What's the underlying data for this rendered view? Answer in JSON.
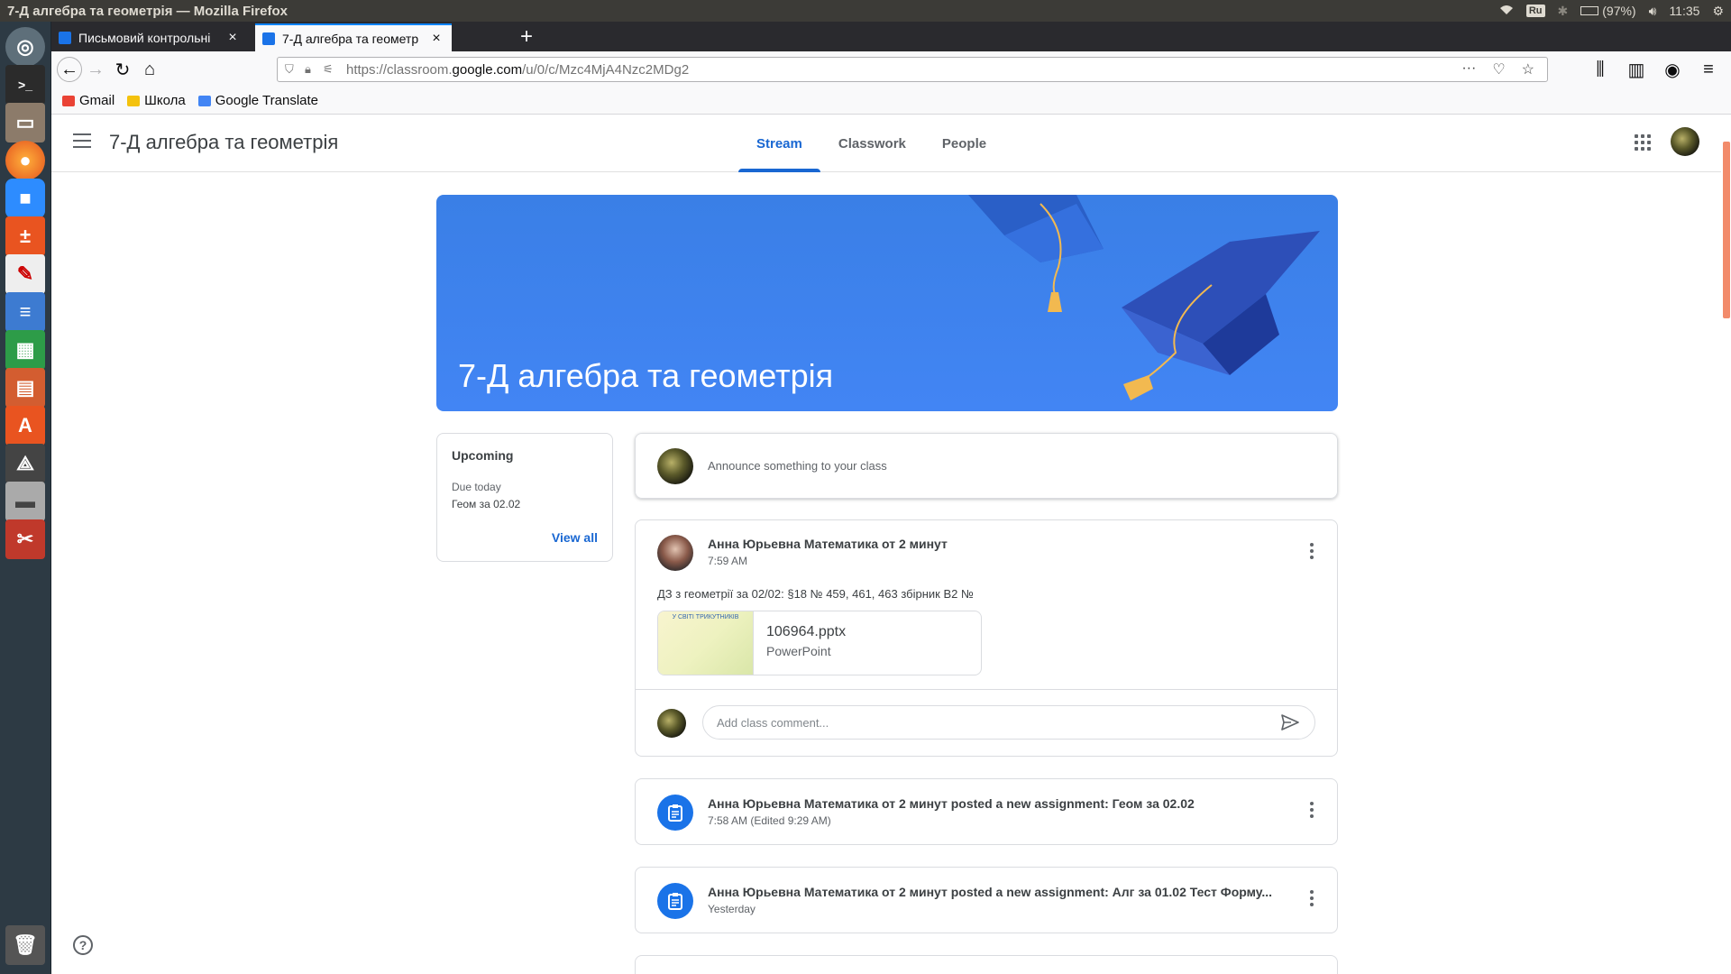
{
  "os": {
    "window_title": "7-Д алгебра та геометрія — Mozilla Firefox",
    "lang": "Ru",
    "battery": "(97%)",
    "clock": "11:35"
  },
  "browser": {
    "tabs": [
      {
        "label": "Письмовий контрольні"
      },
      {
        "label": "7-Д алгебра та геометр"
      }
    ],
    "url_prefix": "https://classroom.",
    "url_domain": "google.com",
    "url_path": "/u/0/c/Mzc4MjA4Nzc2MDg2",
    "bookmarks": [
      {
        "label": "Gmail",
        "color": "#ea4335"
      },
      {
        "label": "Школа",
        "color": "#f4c20d"
      },
      {
        "label": "Google Translate",
        "color": "#4285f4"
      }
    ]
  },
  "classroom": {
    "class_title": "7-Д алгебра та геометрія",
    "tabs": [
      {
        "label": "Stream",
        "active": true
      },
      {
        "label": "Classwork",
        "active": false
      },
      {
        "label": "People",
        "active": false
      }
    ],
    "banner_title": "7-Д алгебра та геометрія",
    "upcoming": {
      "heading": "Upcoming",
      "due_label": "Due today",
      "item": "Геом за 02.02",
      "view_all": "View all"
    },
    "announce_placeholder": "Announce something to your class",
    "posts": [
      {
        "author": "Анна Юрьевна Математика от 2 минут",
        "time": "7:59 AM",
        "body": "ДЗ з геометрії за 02/02: §18 № 459, 461, 463 збірник В2 №",
        "attachment": {
          "name": "106964.pptx",
          "type": "PowerPoint",
          "thumb_text": "У СВІТІ ТРИКУТНИКІВ"
        },
        "comment_placeholder": "Add class comment..."
      }
    ],
    "assignments": [
      {
        "title": "Анна Юрьевна Математика от 2 минут posted a new assignment: Геом за 02.02",
        "time": "7:58 AM (Edited 9:29 AM)"
      },
      {
        "title": "Анна Юрьевна Математика от 2 минут posted a new assignment: Алг за 01.02 Тест Форму...",
        "time": "Yesterday"
      }
    ],
    "accent_color": "#1967d2"
  }
}
